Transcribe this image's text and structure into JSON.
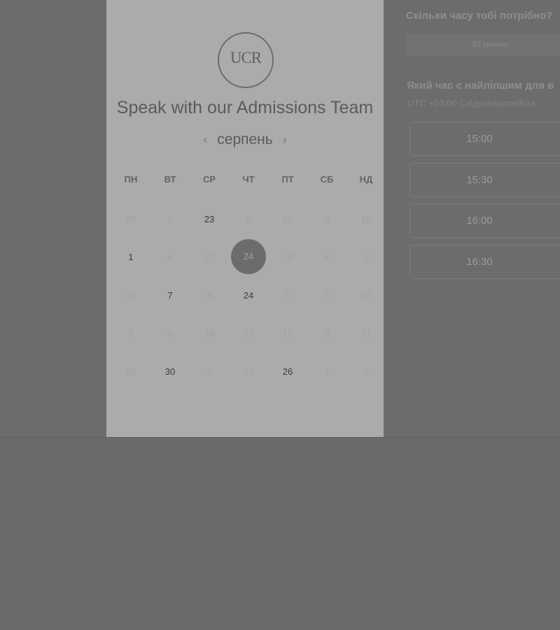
{
  "card": {
    "logo_text": "UCR",
    "title": "Speak with our Admissions Team",
    "month": "серпень",
    "prev_icon": "‹",
    "next_icon": "›"
  },
  "weekdays": [
    "ПН",
    "ВТ",
    "СР",
    "ЧТ",
    "ПТ",
    "СБ",
    "НД"
  ],
  "days": [
    {
      "label": "28",
      "state": "off"
    },
    {
      "label": "5",
      "state": "off"
    },
    {
      "label": "23",
      "state": "on"
    },
    {
      "label": "6",
      "state": "off"
    },
    {
      "label": "29",
      "state": "off"
    },
    {
      "label": "6",
      "state": "off"
    },
    {
      "label": "15",
      "state": "off"
    },
    {
      "label": "1",
      "state": "on"
    },
    {
      "label": "4",
      "state": "off"
    },
    {
      "label": "27",
      "state": "off"
    },
    {
      "label": "24",
      "state": "selected"
    },
    {
      "label": "13",
      "state": "off"
    },
    {
      "label": "6",
      "state": "off"
    },
    {
      "label": "2",
      "state": "off"
    },
    {
      "label": "16",
      "state": "off"
    },
    {
      "label": "7",
      "state": "on"
    },
    {
      "label": "6",
      "state": "off"
    },
    {
      "label": "24",
      "state": "on"
    },
    {
      "label": "5",
      "state": "off"
    },
    {
      "label": "3",
      "state": "off"
    },
    {
      "label": "25",
      "state": "off"
    },
    {
      "label": "5",
      "state": "off"
    },
    {
      "label": "4",
      "state": "off"
    },
    {
      "label": "18",
      "state": "off"
    },
    {
      "label": "21",
      "state": "off"
    },
    {
      "label": "17",
      "state": "off"
    },
    {
      "label": "8",
      "state": "off"
    },
    {
      "label": "31",
      "state": "off"
    },
    {
      "label": "26",
      "state": "off"
    },
    {
      "label": "30",
      "state": "on"
    },
    {
      "label": "4",
      "state": "off"
    },
    {
      "label": "13",
      "state": "off"
    },
    {
      "label": "26",
      "state": "on"
    },
    {
      "label": "1",
      "state": "off"
    },
    {
      "label": "3",
      "state": "off"
    }
  ],
  "right": {
    "duration_question": "Скільки часу тобі потрібно?",
    "duration_value": "30 хвилин",
    "time_question": "Який час є найліпшим для в",
    "timezone": "UTC +03:00 Східноєвропейськ",
    "slots": [
      "15:00",
      "15:30",
      "16:00",
      "16:30"
    ]
  },
  "colors": {
    "overlay_bg": "#6c6c6c",
    "card_bg": "#ababab",
    "selected_day": "#6c6c6c"
  }
}
